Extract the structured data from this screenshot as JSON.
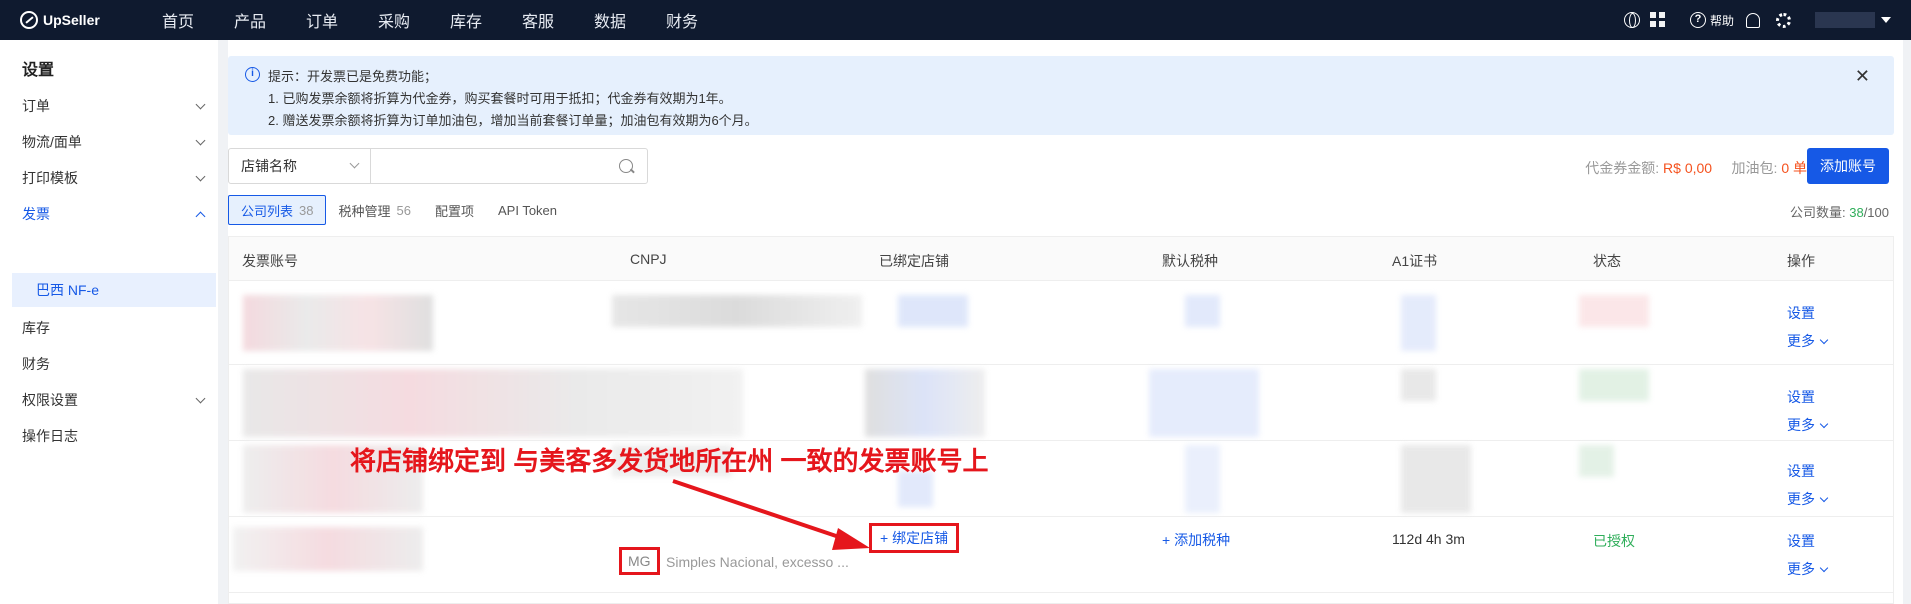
{
  "topbar": {
    "logo": "UpSeller",
    "nav": [
      "首页",
      "产品",
      "订单",
      "采购",
      "库存",
      "客服",
      "数据",
      "财务"
    ],
    "help": "帮助"
  },
  "sidebar": {
    "title": "设置",
    "items": [
      {
        "label": "订单",
        "expandable": true
      },
      {
        "label": "物流/面单",
        "expandable": true
      },
      {
        "label": "打印模板",
        "expandable": true
      },
      {
        "label": "发票",
        "expandable": true,
        "open": true
      },
      {
        "label": "库存",
        "expandable": false
      },
      {
        "label": "财务",
        "expandable": false
      },
      {
        "label": "权限设置",
        "expandable": true
      },
      {
        "label": "操作日志",
        "expandable": false
      }
    ],
    "sub_active": "巴西 NF-e"
  },
  "notice": {
    "line1": "提示：开发票已是免费功能；",
    "line2": "1. 已购发票余额将折算为代金券，购买套餐时可用于抵扣；代金券有效期为1年。",
    "line3": "2. 赠送发票余额将折算为订单加油包，增加当前套餐订单量；加油包有效期为6个月。"
  },
  "filter": {
    "select": "店铺名称",
    "placeholder": ""
  },
  "vouchers": {
    "label": "代金券金额:",
    "amount": "R$ 0,00",
    "fuel_label": "加油包:",
    "fuel_value": "0 单"
  },
  "add_button": "添加账号",
  "tabs": [
    {
      "label": "公司列表",
      "count": "38",
      "active": true
    },
    {
      "label": "税种管理",
      "count": "56"
    },
    {
      "label": "配置项",
      "count": ""
    },
    {
      "label": "API Token",
      "count": ""
    }
  ],
  "company_count": {
    "label": "公司数量:",
    "used": "38",
    "total": "/100"
  },
  "table": {
    "headers": [
      "发票账号",
      "CNPJ",
      "已绑定店铺",
      "默认税种",
      "A1证书",
      "状态",
      "操作"
    ],
    "row_actions": {
      "settings": "设置",
      "more": "更多"
    },
    "last_row": {
      "region": "MG",
      "regime": "Simples Nacional, excesso ...",
      "bind_store": "+ 绑定店铺",
      "add_tax": "+ 添加税种",
      "cert": "112d 4h 3m",
      "status": "已授权"
    }
  },
  "annotation": "将店铺绑定到 与美客多发货地所在州 一致的发票账号上",
  "colors": {
    "primary": "#1659e6",
    "annotation": "#e5161c",
    "success": "#2fae5a",
    "warning": "#f5521e"
  }
}
